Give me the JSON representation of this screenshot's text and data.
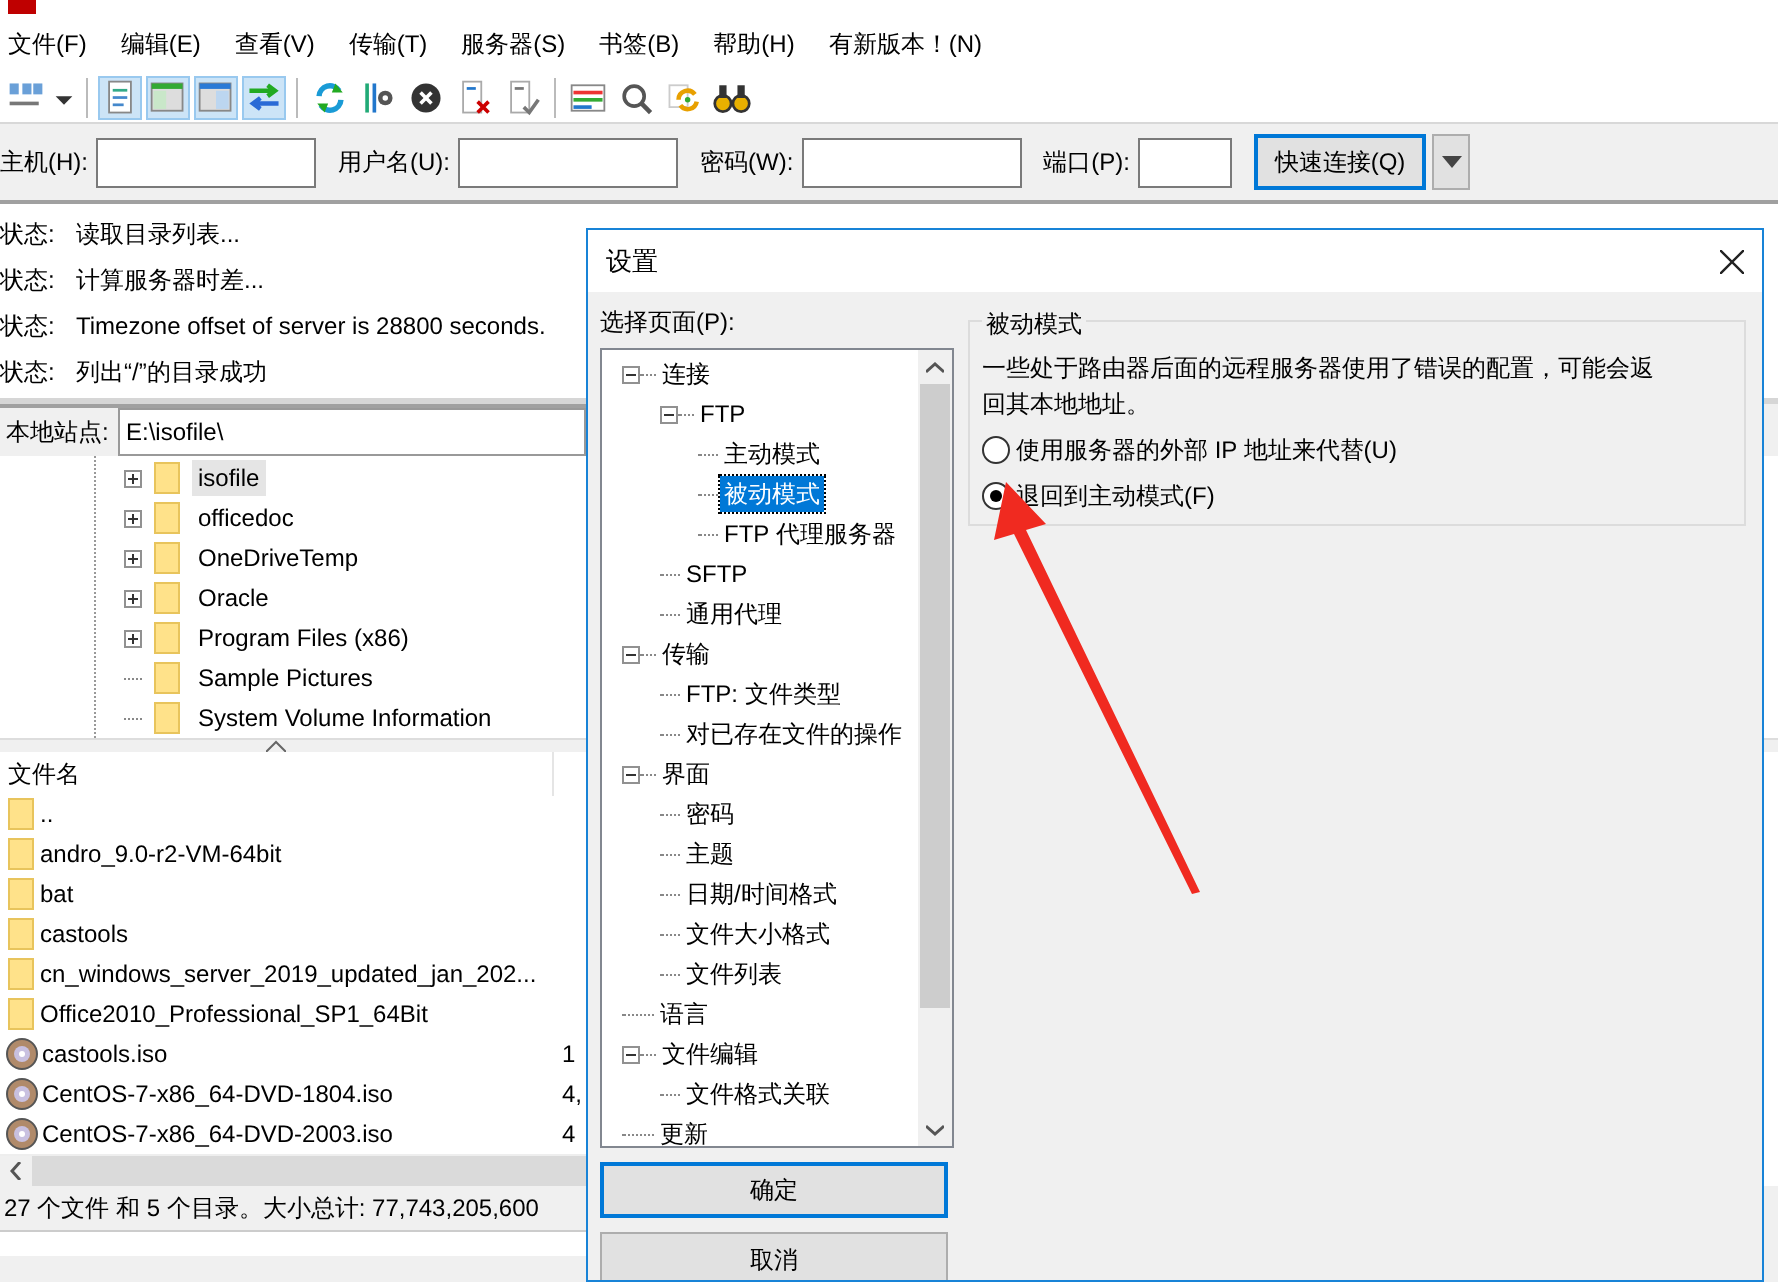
{
  "menu": [
    "文件(F)",
    "编辑(E)",
    "查看(V)",
    "传输(T)",
    "服务器(S)",
    "书签(B)",
    "帮助(H)",
    "有新版本！(N)"
  ],
  "quickconnect": {
    "fields": [
      {
        "label": "主机(H):",
        "kind": "wide"
      },
      {
        "label": "用户名(U):",
        "kind": "wide"
      },
      {
        "label": "密码(W):",
        "kind": "wide"
      },
      {
        "label": "端口(P):",
        "kind": "narrow"
      }
    ],
    "button": "快速连接(Q)"
  },
  "log": [
    {
      "label": "状态:",
      "message": "读取目录列表..."
    },
    {
      "label": "状态:",
      "message": "计算服务器时差..."
    },
    {
      "label": "状态:",
      "message": "Timezone offset of server is 28800 seconds."
    },
    {
      "label": "状态:",
      "message": "列出“/”的目录成功"
    }
  ],
  "local_site": {
    "label": "本地站点:",
    "path": "E:\\isofile\\"
  },
  "local_tree": [
    {
      "name": "isofile",
      "expandable": true,
      "selected": true
    },
    {
      "name": "officedoc",
      "expandable": true,
      "selected": false
    },
    {
      "name": "OneDriveTemp",
      "expandable": true,
      "selected": false
    },
    {
      "name": "Oracle",
      "expandable": true,
      "selected": false
    },
    {
      "name": "Program Files (x86)",
      "expandable": true,
      "selected": false
    },
    {
      "name": "Sample Pictures",
      "expandable": false,
      "selected": false
    },
    {
      "name": "System Volume Information",
      "expandable": false,
      "selected": false
    }
  ],
  "file_list": {
    "columns": [
      "文件名"
    ],
    "rows": [
      {
        "name": "..",
        "kind": "folder"
      },
      {
        "name": "andro_9.0-r2-VM-64bit",
        "kind": "folder"
      },
      {
        "name": "bat",
        "kind": "folder"
      },
      {
        "name": "castools",
        "kind": "folder"
      },
      {
        "name": "cn_windows_server_2019_updated_jan_202...",
        "kind": "folder"
      },
      {
        "name": "Office2010_Professional_SP1_64Bit",
        "kind": "folder"
      },
      {
        "name": "castools.iso",
        "kind": "disc",
        "size": "1"
      },
      {
        "name": "CentOS-7-x86_64-DVD-1804.iso",
        "kind": "disc",
        "size": "4,"
      },
      {
        "name": "CentOS-7-x86_64-DVD-2003.iso",
        "kind": "disc",
        "size": "4"
      }
    ]
  },
  "status_bar": "27 个文件 和 5 个目录。大小总计: 77,743,205,600",
  "dialog": {
    "title": "设置",
    "page_label": "选择页面(P):",
    "tree": [
      {
        "name": "连接",
        "expanded": true,
        "selected": false,
        "children": [
          {
            "name": "FTP",
            "expanded": true,
            "selected": false,
            "children": [
              {
                "name": "主动模式",
                "selected": false
              },
              {
                "name": "被动模式",
                "selected": true
              },
              {
                "name": "FTP 代理服务器",
                "selected": false
              }
            ]
          },
          {
            "name": "SFTP",
            "selected": false
          },
          {
            "name": "通用代理",
            "selected": false
          }
        ]
      },
      {
        "name": "传输",
        "expanded": true,
        "selected": false,
        "children": [
          {
            "name": "FTP: 文件类型",
            "selected": false
          },
          {
            "name": "对已存在文件的操作",
            "selected": false
          }
        ]
      },
      {
        "name": "界面",
        "expanded": true,
        "selected": false,
        "children": [
          {
            "name": "密码",
            "selected": false
          },
          {
            "name": "主题",
            "selected": false
          },
          {
            "name": "日期/时间格式",
            "selected": false
          },
          {
            "name": "文件大小格式",
            "selected": false
          },
          {
            "name": "文件列表",
            "selected": false
          }
        ]
      },
      {
        "name": "语言",
        "selected": false
      },
      {
        "name": "文件编辑",
        "expanded": true,
        "selected": false,
        "children": [
          {
            "name": "文件格式关联",
            "selected": false
          }
        ]
      },
      {
        "name": "更新",
        "selected": false
      }
    ],
    "buttons": [
      {
        "label": "确定",
        "default": true
      },
      {
        "label": "取消",
        "default": false
      }
    ],
    "group": {
      "title": "被动模式",
      "description": "一些处于路由器后面的远程服务器使用了错误的配置，可能会返回其本地地址。",
      "radios": [
        {
          "label": "使用服务器的外部 IP 地址来代替(U)",
          "selected": false
        },
        {
          "label": "退回到主动模式(F)",
          "selected": true
        }
      ]
    }
  }
}
